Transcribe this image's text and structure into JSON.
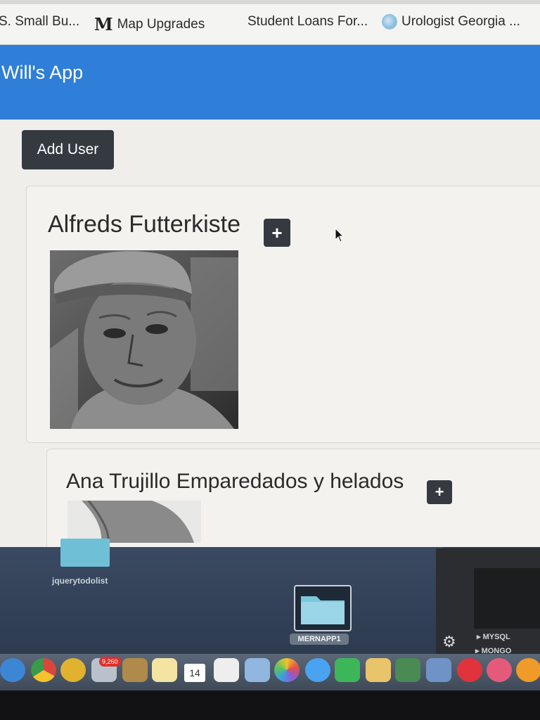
{
  "bookmarks": [
    {
      "label": "S. Small Bu...",
      "icon": "none"
    },
    {
      "label": "Map Upgrades",
      "icon": "m-logo-icon"
    },
    {
      "label": "Student Loans For...",
      "icon": "none"
    },
    {
      "label": "Urologist Georgia ...",
      "icon": "globe-icon"
    }
  ],
  "bookmark_m_glyph": "M",
  "app": {
    "title": "Will's App",
    "navbar_color": "#2f7ed8"
  },
  "toolbar": {
    "add_user_label": "Add User"
  },
  "cards": [
    {
      "name": "Alfreds Futterkiste",
      "plus_label": "+"
    },
    {
      "name": "Ana Trujillo Emparedados y helados",
      "plus_label": "+"
    }
  ],
  "desktop": {
    "folders": [
      "jquerytodolist",
      "MERNAPP1"
    ],
    "databases": [
      "MYSQL",
      "MONGO"
    ]
  },
  "dock": {
    "badge": "9,260",
    "calendar_day": "14"
  }
}
